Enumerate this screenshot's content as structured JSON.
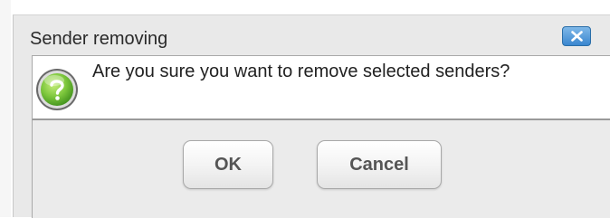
{
  "dialog": {
    "title": "Sender removing",
    "close_icon": "close-icon",
    "message": "Are you sure you want to remove selected senders?",
    "message_icon": "question-icon",
    "buttons": {
      "ok_label": "OK",
      "cancel_label": "Cancel"
    }
  },
  "colors": {
    "close_button": "#3a86cf",
    "question_icon": "#6cbf3a",
    "dialog_background": "#e9e9e9"
  }
}
